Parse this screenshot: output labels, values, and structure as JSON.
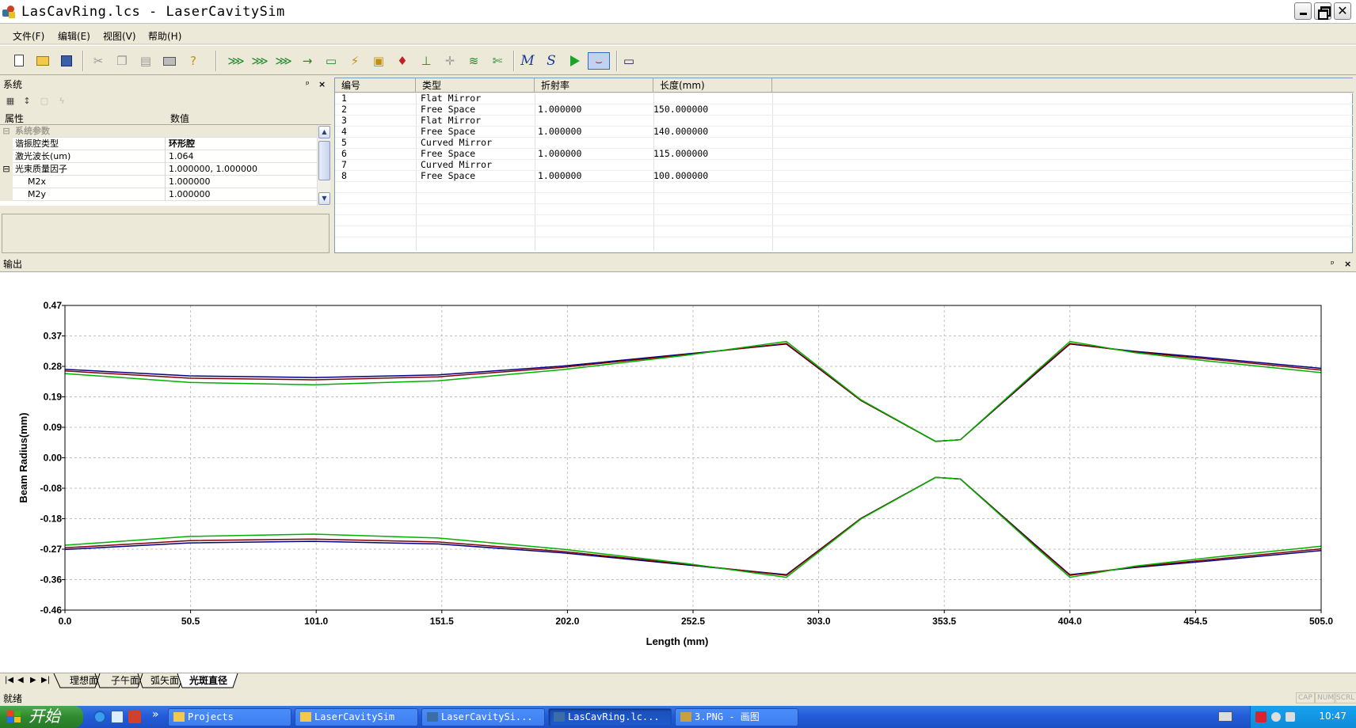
{
  "window": {
    "title": "LasCavRing.lcs - LaserCavitySim",
    "close_label": "✕"
  },
  "menu": [
    "文件(F)",
    "编辑(E)",
    "视图(V)",
    "帮助(H)"
  ],
  "toolbar": {
    "buttons": [
      "new-icon",
      "open-icon",
      "save-icon",
      "cut-icon",
      "copy-icon",
      "paste-icon",
      "print-icon",
      "help-icon",
      "flat-mirror-icon",
      "curved-mirror-icon",
      "lens-icon",
      "free-space-icon",
      "crystal-icon",
      "wand-icon",
      "window-icon",
      "rod-icon",
      "plane-icon",
      "axis-icon",
      "beam-icon",
      "scissors-icon",
      "m-icon",
      "s-icon",
      "run-icon",
      "beam-profile-icon",
      "screen-icon"
    ],
    "italic_m": "M",
    "italic_s": "S",
    "help_suffix": "?"
  },
  "properties_panel": {
    "title": "系统",
    "header_property": "属性",
    "header_value": "数值",
    "rows": [
      {
        "type": "category",
        "toggle": "⊟",
        "name": "系统参数",
        "value": ""
      },
      {
        "type": "item",
        "toggle": "",
        "name": "谐振腔类型",
        "value": "环形腔",
        "bold_value": true
      },
      {
        "type": "item",
        "toggle": "",
        "name": "激光波长(um)",
        "value": "1.064"
      },
      {
        "type": "group",
        "toggle": "⊟",
        "name": "光束质量因子",
        "value": "1.000000, 1.000000"
      },
      {
        "type": "sub",
        "toggle": "",
        "name": "M2x",
        "value": "1.000000"
      },
      {
        "type": "sub",
        "toggle": "",
        "name": "M2y",
        "value": "1.000000"
      }
    ]
  },
  "elements_table": {
    "columns": [
      "编号",
      "类型",
      "折射率",
      "长度(mm)"
    ],
    "rows": [
      {
        "id": "1",
        "type": "Flat Mirror",
        "index": "",
        "length": ""
      },
      {
        "id": "2",
        "type": "Free Space",
        "index": "1.000000",
        "length": "150.000000"
      },
      {
        "id": "3",
        "type": "Flat Mirror",
        "index": "",
        "length": ""
      },
      {
        "id": "4",
        "type": "Free Space",
        "index": "1.000000",
        "length": "140.000000"
      },
      {
        "id": "5",
        "type": "Curved Mirror",
        "index": "",
        "length": ""
      },
      {
        "id": "6",
        "type": "Free Space",
        "index": "1.000000",
        "length": "115.000000"
      },
      {
        "id": "7",
        "type": "Curved Mirror",
        "index": "",
        "length": ""
      },
      {
        "id": "8",
        "type": "Free Space",
        "index": "1.000000",
        "length": "100.000000"
      }
    ]
  },
  "output_panel": {
    "title": "输出"
  },
  "chart_data": {
    "type": "line",
    "title": "",
    "xlabel": "Length (mm)",
    "ylabel": "Beam Radius(mm)",
    "xlim": [
      0.0,
      505.0
    ],
    "ylim": [
      -0.46,
      0.47
    ],
    "x_ticks": [
      "0.0",
      "50.5",
      "101.0",
      "151.5",
      "202.0",
      "252.5",
      "303.0",
      "353.5",
      "404.0",
      "454.5",
      "505.0"
    ],
    "y_ticks": [
      "0.47",
      "0.37",
      "0.28",
      "0.19",
      "0.09",
      "0.00",
      "-0.08",
      "-0.18",
      "-0.27",
      "-0.36",
      "-0.46"
    ],
    "grid": true,
    "series": [
      {
        "color": "#000080",
        "x": [
          0,
          50,
          100,
          150,
          200,
          250,
          290,
          320,
          350,
          360,
          390,
          404,
          430,
          460,
          505
        ],
        "y": [
          0.275,
          0.255,
          0.25,
          0.258,
          0.285,
          0.322,
          0.352,
          0.18,
          0.055,
          0.06,
          0.26,
          0.352,
          0.33,
          0.31,
          0.278
        ]
      },
      {
        "color": "#800000",
        "x": [
          0,
          50,
          100,
          150,
          200,
          250,
          290,
          320,
          350,
          360,
          390,
          404,
          430,
          460,
          505
        ],
        "y": [
          0.27,
          0.248,
          0.243,
          0.252,
          0.281,
          0.32,
          0.354,
          0.18,
          0.055,
          0.06,
          0.262,
          0.354,
          0.328,
          0.306,
          0.273
        ]
      },
      {
        "color": "#00b000",
        "x": [
          0,
          50,
          100,
          150,
          200,
          250,
          290,
          320,
          350,
          360,
          390,
          404,
          430,
          460,
          505
        ],
        "y": [
          0.262,
          0.235,
          0.228,
          0.24,
          0.274,
          0.318,
          0.36,
          0.182,
          0.055,
          0.06,
          0.266,
          0.36,
          0.326,
          0.3,
          0.265
        ]
      },
      {
        "color": "#000080",
        "x": [
          0,
          50,
          100,
          150,
          200,
          250,
          290,
          320,
          350,
          360,
          390,
          404,
          430,
          460,
          505
        ],
        "y": [
          -0.275,
          -0.255,
          -0.25,
          -0.258,
          -0.285,
          -0.322,
          -0.352,
          -0.18,
          -0.055,
          -0.06,
          -0.26,
          -0.352,
          -0.33,
          -0.31,
          -0.278
        ]
      },
      {
        "color": "#800000",
        "x": [
          0,
          50,
          100,
          150,
          200,
          250,
          290,
          320,
          350,
          360,
          390,
          404,
          430,
          460,
          505
        ],
        "y": [
          -0.27,
          -0.248,
          -0.243,
          -0.252,
          -0.281,
          -0.32,
          -0.354,
          -0.18,
          -0.055,
          -0.06,
          -0.262,
          -0.354,
          -0.328,
          -0.306,
          -0.273
        ]
      },
      {
        "color": "#00b000",
        "x": [
          0,
          50,
          100,
          150,
          200,
          250,
          290,
          320,
          350,
          360,
          390,
          404,
          430,
          460,
          505
        ],
        "y": [
          -0.262,
          -0.235,
          -0.228,
          -0.24,
          -0.274,
          -0.318,
          -0.36,
          -0.182,
          -0.055,
          -0.06,
          -0.266,
          -0.36,
          -0.326,
          -0.3,
          -0.265
        ]
      }
    ]
  },
  "sheet_tabs": {
    "nav": [
      "|◀",
      "◀",
      "▶",
      "▶|"
    ],
    "tabs": [
      "理想面",
      "子午面",
      "弧矢面",
      "光斑直径"
    ],
    "active": 3
  },
  "status": {
    "text": "就绪",
    "indicators": [
      "CAP",
      "NUM",
      "SCRL"
    ]
  },
  "taskbar": {
    "start_label": "开始",
    "more": "»",
    "tasks": [
      "Projects",
      "LaserCavitySim",
      "LaserCavitySi...",
      "LasCavRing.lc...",
      "3.PNG - 画图"
    ],
    "active_task": 3,
    "clock": "10:47"
  }
}
